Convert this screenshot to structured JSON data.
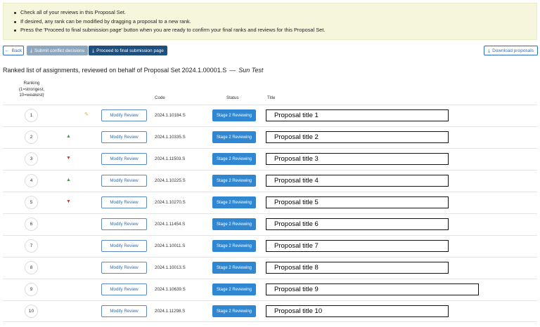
{
  "instructions": [
    "Check all of your reviews in this Proposal Set.",
    "If desired, any rank can be modified by dragging a proposal to a new rank.",
    "Press the 'Proceed to final submission page' button when you are ready to confirm your final ranks and reviews for this Proposal Set."
  ],
  "toolbar": {
    "back_label": "Back",
    "conflict_label": "Submit conflict decisions",
    "final_label": "Proceed to final submission page",
    "download_label": "Download proposals"
  },
  "heading": {
    "text": "Ranked list of assignments, reviewed on behalf of Proposal Set 2024.1.00001.S",
    "separator": "—",
    "reviewer": "Sun Test"
  },
  "table": {
    "headers": {
      "ranking_line1": "Ranking",
      "ranking_line2": "(1=strongest,",
      "ranking_line3": "10=weakest)",
      "code": "Code",
      "status": "Status",
      "title": "Title"
    },
    "rows": [
      {
        "rank": "1",
        "indicator": "edit",
        "modify_label": "Modify Review",
        "code": "2024.1.10184.S",
        "status": "Stage 2 Reviewing",
        "title": "Proposal title 1"
      },
      {
        "rank": "2",
        "indicator": "up",
        "modify_label": "Modify Review",
        "code": "2024.1.10335.S",
        "status": "Stage 2 Reviewing",
        "title": "Proposal title 2"
      },
      {
        "rank": "3",
        "indicator": "down",
        "modify_label": "Modify Review",
        "code": "2024.1.11503.S",
        "status": "Stage 2 Reviewing",
        "title": "Proposal title 3"
      },
      {
        "rank": "4",
        "indicator": "up",
        "modify_label": "Modify Review",
        "code": "2024.1.10225.S",
        "status": "Stage 2 Reviewing",
        "title": "Proposal title 4"
      },
      {
        "rank": "5",
        "indicator": "down",
        "modify_label": "Modify Review",
        "code": "2024.1.10270.S",
        "status": "Stage 2 Reviewing",
        "title": "Proposal title 5"
      },
      {
        "rank": "6",
        "indicator": "none",
        "modify_label": "Modify Review",
        "code": "2024.1.11454.S",
        "status": "Stage 2 Reviewing",
        "title": "Proposal title 6"
      },
      {
        "rank": "7",
        "indicator": "none",
        "modify_label": "Modify Review",
        "code": "2024.1.10011.S",
        "status": "Stage 2 Reviewing",
        "title": "Proposal title 7"
      },
      {
        "rank": "8",
        "indicator": "none",
        "modify_label": "Modify Review",
        "code": "2024.1.10013.S",
        "status": "Stage 2 Reviewing",
        "title": "Proposal title 8"
      },
      {
        "rank": "9",
        "indicator": "none",
        "modify_label": "Modify Review",
        "code": "2024.1.10639.S",
        "status": "Stage 2 Reviewing",
        "title": "Proposal title 9"
      },
      {
        "rank": "10",
        "indicator": "none",
        "modify_label": "Modify Review",
        "code": "2024.1.11298.S",
        "status": "Stage 2 Reviewing",
        "title": "Proposal title 10"
      }
    ]
  },
  "icons": {
    "back": "arrow-left-icon",
    "conflict": "download-icon",
    "final": "download-icon",
    "download": "download-icon",
    "edit": "pencil-icon",
    "up": "triangle-up-icon",
    "down": "triangle-down-icon"
  },
  "colors": {
    "notice_bg": "#f6f6dd",
    "primary": "#2f6fb5",
    "status_bg": "#2f86d1",
    "final_bg": "#1f4f7e",
    "up": "#39a04a",
    "down": "#d23a2a",
    "edit": "#e8a630"
  }
}
